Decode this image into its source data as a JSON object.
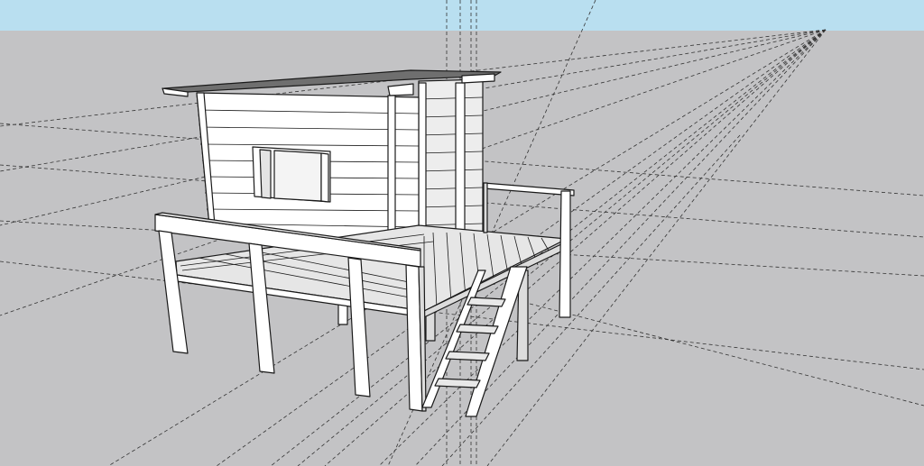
{
  "viewport": {
    "style": "sketchup-default",
    "sky_color": "#b9dff0",
    "ground_color": "#c3c3c5",
    "face_color": "#ffffff",
    "shade_color": "#dcdcdc",
    "dark_face_color": "#9a9a9a",
    "edge_color": "#1a1a1a",
    "guide_style": "dashed"
  },
  "model": {
    "subject": "playhouse-on-stilts",
    "components": [
      "shed-roof",
      "clad-cabin",
      "cabin-window",
      "deck",
      "deck-railing",
      "support-posts",
      "ladder"
    ]
  }
}
